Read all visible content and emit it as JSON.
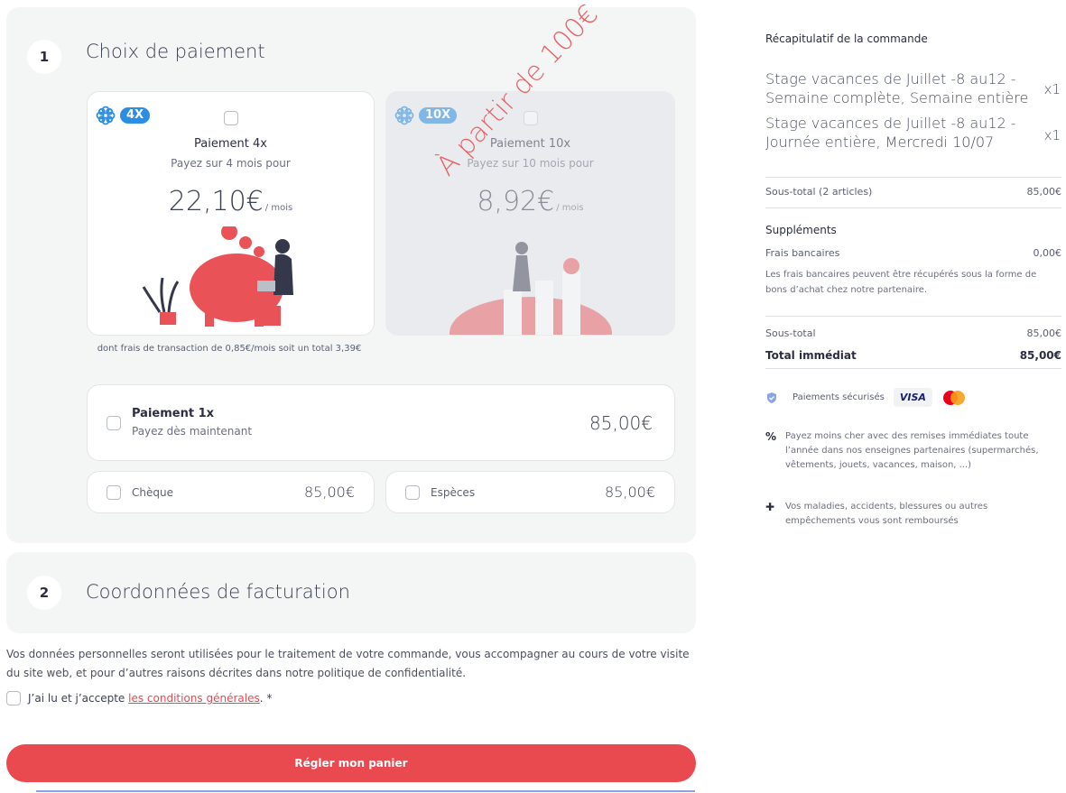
{
  "step1": {
    "number": "1",
    "title": "Choix de paiement",
    "option4x": {
      "badge": "4X",
      "title": "Paiement 4x",
      "subtitle": "Payez sur 4 mois pour",
      "price": "22,10€",
      "unit": "/ mois",
      "fee_note": "dont frais de transaction de 0,85€/mois  soit un total 3,39€"
    },
    "option10x": {
      "badge": "10X",
      "title": "Paiement 10x",
      "subtitle": "Payez sur 10 mois pour",
      "price": "8,92€",
      "unit": "/ mois",
      "stamp": "À partir de 100€"
    },
    "option1x": {
      "title": "Paiement 1x",
      "subtitle": "Payez dès maintenant",
      "price": "85,00€"
    },
    "cheque": {
      "label": "Chèque",
      "price": "85,00€"
    },
    "especes": {
      "label": "Espèces",
      "price": "85,00€"
    }
  },
  "step2": {
    "number": "2",
    "title": "Coordonnées de facturation"
  },
  "privacy_text": "Vos données personnelles seront utilisées pour le traitement de votre commande, vous accompagner au cours de votre visite du site web, et pour d’autres raisons décrites dans notre politique de confidentialité.",
  "terms": {
    "prefix": "J’ai lu et j’accepte",
    "link": "les conditions générales",
    "suffix": ". *"
  },
  "pay_button": "Régler mon panier",
  "summary": {
    "title": "Récapitulatif de la commande",
    "items": [
      {
        "name": "Stage vacances de Juillet -8 au12 - Semaine complète, Semaine entière",
        "qty": "x1"
      },
      {
        "name": "Stage vacances de Juillet -8 au12 - Journée entière, Mercredi 10/07",
        "qty": "x1"
      }
    ],
    "subtotal_label": "Sous-total (2 articles)",
    "subtotal_value": "85,00€",
    "supplements_title": "Suppléments",
    "bank_fees_label": "Frais bancaires",
    "bank_fees_value": "0,00€",
    "bank_fees_note": "Les frais bancaires peuvent être récupérés sous la forme de bons d’achat chez notre partenaire.",
    "subtotal2_label": "Sous-total",
    "subtotal2_value": "85,00€",
    "total_label": "Total immédiat",
    "total_value": "85,00€",
    "secure_label": "Paiements sécurisés",
    "visa": "VISA",
    "perk1": "Payez moins cher avec des remises immédiates toute l’année dans nos enseignes partenaires (supermarchés, vêtements, jouets, vacances, maison, ...)",
    "perk2": "Vos maladies, accidents, blessures ou autres empêchements vous sont remboursés"
  },
  "colors": {
    "accent": "#e84a4f",
    "badge_blue": "#2b8de3",
    "panel_bg": "#f4f5f5"
  }
}
